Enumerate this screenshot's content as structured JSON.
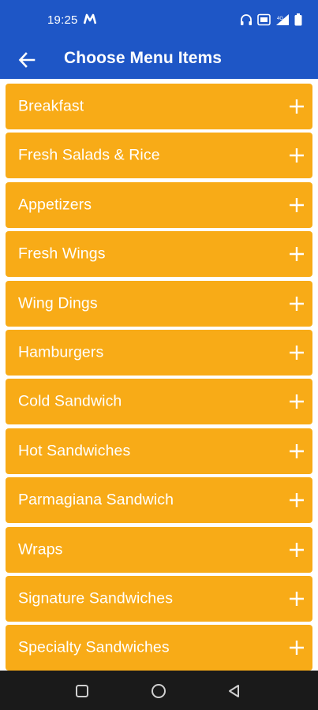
{
  "status_bar": {
    "time": "19:25",
    "icons": [
      "m-app-icon",
      "headphones-icon",
      "cast-icon",
      "signal-icon",
      "battery-icon"
    ]
  },
  "app_bar": {
    "title": "Choose Menu Items",
    "back_icon": "arrow-left-icon"
  },
  "menu": {
    "items": [
      {
        "label": "Breakfast"
      },
      {
        "label": "Fresh Salads & Rice"
      },
      {
        "label": "Appetizers"
      },
      {
        "label": "Fresh Wings"
      },
      {
        "label": "Wing Dings"
      },
      {
        "label": "Hamburgers"
      },
      {
        "label": "Cold Sandwich"
      },
      {
        "label": "Hot Sandwiches"
      },
      {
        "label": "Parmagiana Sandwich"
      },
      {
        "label": "Wraps"
      },
      {
        "label": "Signature Sandwiches"
      },
      {
        "label": "Specialty Sandwiches"
      }
    ],
    "expand_icon": "plus-icon"
  },
  "nav_bar": {
    "buttons": [
      "recents-square-icon",
      "home-circle-icon",
      "back-triangle-icon"
    ]
  },
  "colors": {
    "primary": "#1e56c6",
    "item_background": "#f8ab17",
    "item_text": "#ffffff"
  }
}
